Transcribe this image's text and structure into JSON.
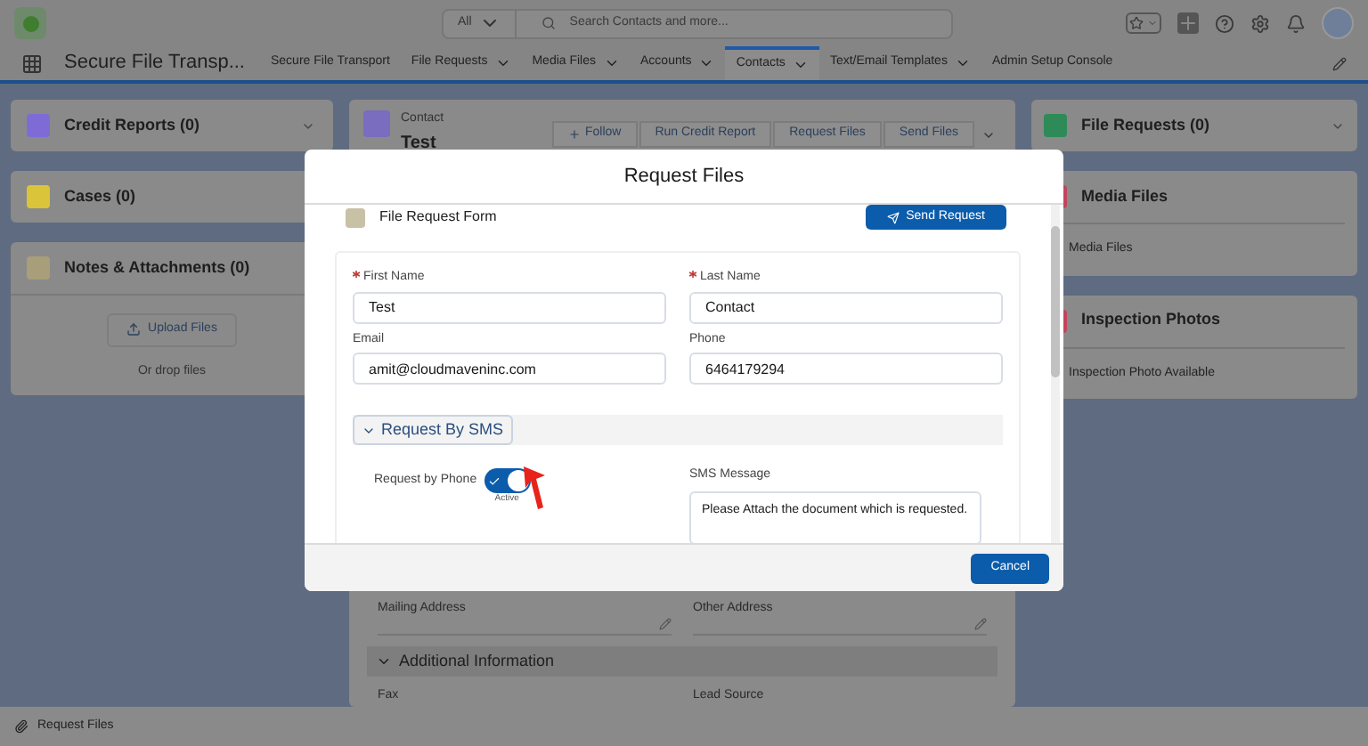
{
  "header": {
    "search_scope": "All",
    "search_placeholder": "Search Contacts and more..."
  },
  "nav": {
    "app_name": "Secure File Transp...",
    "tabs": [
      {
        "label": "Secure File Transport",
        "menu": false,
        "selected": false
      },
      {
        "label": "File Requests",
        "menu": true,
        "selected": false
      },
      {
        "label": "Media Files",
        "menu": true,
        "selected": false
      },
      {
        "label": "Accounts",
        "menu": true,
        "selected": false
      },
      {
        "label": "Contacts",
        "menu": true,
        "selected": true
      },
      {
        "label": "Text/Email Templates",
        "menu": true,
        "selected": false
      },
      {
        "label": "Admin Setup Console",
        "menu": false,
        "selected": false
      }
    ]
  },
  "left_cards": [
    {
      "kind": "collapsed",
      "title": "Credit Reports (0)",
      "color": "#7f6bd6",
      "menu": true
    },
    {
      "kind": "collapsed",
      "title": "Cases (0)",
      "color": "#d9c43a"
    },
    {
      "kind": "upload",
      "title": "Notes & Attachments (0)",
      "color": "#a89e7a",
      "button": "Upload Files",
      "hint": "Or drop files"
    }
  ],
  "record": {
    "type": "Contact",
    "name": "Test",
    "actions": [
      "Follow",
      "Run Credit Report",
      "Request Files",
      "Send Files"
    ]
  },
  "details": {
    "fields": [
      "Mailing Address",
      "Other Address"
    ],
    "section": "Additional Information",
    "more_fields": [
      "Fax",
      "Lead Source"
    ]
  },
  "right_cards": [
    {
      "kind": "icon",
      "title": "File Requests (0)",
      "color": "#2e8b57"
    },
    {
      "kind": "list",
      "title": "Media Files",
      "color": "#c2455b",
      "body": "Media Files"
    },
    {
      "kind": "list",
      "title": "Inspection Photos",
      "color": "#c2455b",
      "body": "Inspection Photo Available"
    }
  ],
  "modal": {
    "title": "Request Files",
    "form_title": "File Request Form",
    "send_button": "Send Request",
    "fields": [
      {
        "label": "First Name",
        "required": true,
        "value": "Test"
      },
      {
        "label": "Last Name",
        "required": true,
        "value": "Contact"
      },
      {
        "label": "Email",
        "required": false,
        "value": "amit@cloudmaveninc.com"
      },
      {
        "label": "Phone",
        "required": false,
        "value": "6464179294"
      }
    ],
    "section": {
      "title": "Request By SMS",
      "expanded": true
    },
    "toggle": {
      "label": "Request by Phone",
      "on": true,
      "state_text": "Active"
    },
    "sms": {
      "label": "SMS Message",
      "value": "Please Attach the document which is requested."
    },
    "cancel": "Cancel"
  },
  "utility_bar": {
    "item": "Request Files"
  }
}
